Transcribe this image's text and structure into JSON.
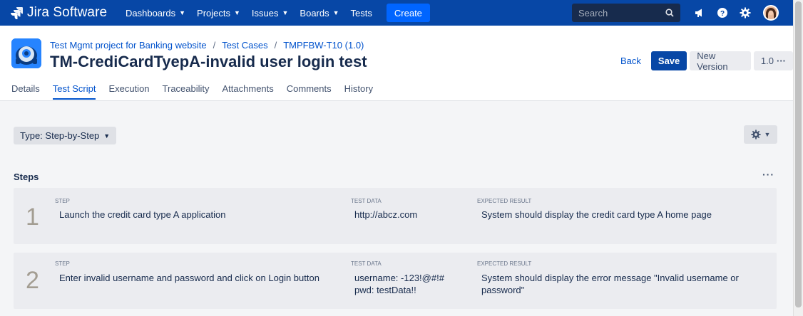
{
  "topnav": {
    "brand": "Jira Software",
    "items": [
      {
        "label": "Dashboards",
        "dropdown": true
      },
      {
        "label": "Projects",
        "dropdown": true
      },
      {
        "label": "Issues",
        "dropdown": true
      },
      {
        "label": "Boards",
        "dropdown": true
      },
      {
        "label": "Tests",
        "dropdown": false
      }
    ],
    "create_label": "Create",
    "search_placeholder": "Search"
  },
  "header": {
    "breadcrumbs": [
      "Test Mgmt project for Banking website",
      "Test Cases",
      "TMPFBW-T10 (1.0)"
    ],
    "title": "TM-CrediCardTyepA-invalid user login test",
    "back_label": "Back",
    "save_label": "Save",
    "new_version_label": "New Version",
    "version_label": "1.0"
  },
  "tabs": [
    {
      "label": "Details",
      "active": false
    },
    {
      "label": "Test Script",
      "active": true
    },
    {
      "label": "Execution",
      "active": false
    },
    {
      "label": "Traceability",
      "active": false
    },
    {
      "label": "Attachments",
      "active": false
    },
    {
      "label": "Comments",
      "active": false
    },
    {
      "label": "History",
      "active": false
    }
  ],
  "script": {
    "type_label": "Type: Step-by-Step",
    "steps_title": "Steps",
    "column_labels": {
      "step": "STEP",
      "test_data": "TEST DATA",
      "expected": "EXPECTED RESULT"
    },
    "steps": [
      {
        "number": "1",
        "step": "Launch the credit card type A application",
        "test_data": [
          "http://abcz.com"
        ],
        "expected": [
          "System should display the credit card type A home page"
        ]
      },
      {
        "number": "2",
        "step": "Enter invalid username and password and click on Login button",
        "test_data": [
          "username: -123!@#!#",
          "pwd: testData!!"
        ],
        "expected": [
          "System should display the error message \"Invalid username or",
          "password\""
        ]
      }
    ]
  },
  "colors": {
    "nav_bg": "#0747a6",
    "primary": "#0052cc",
    "create": "#0065ff",
    "page_bg": "#f4f5f7",
    "row_bg": "#ebecf0"
  }
}
